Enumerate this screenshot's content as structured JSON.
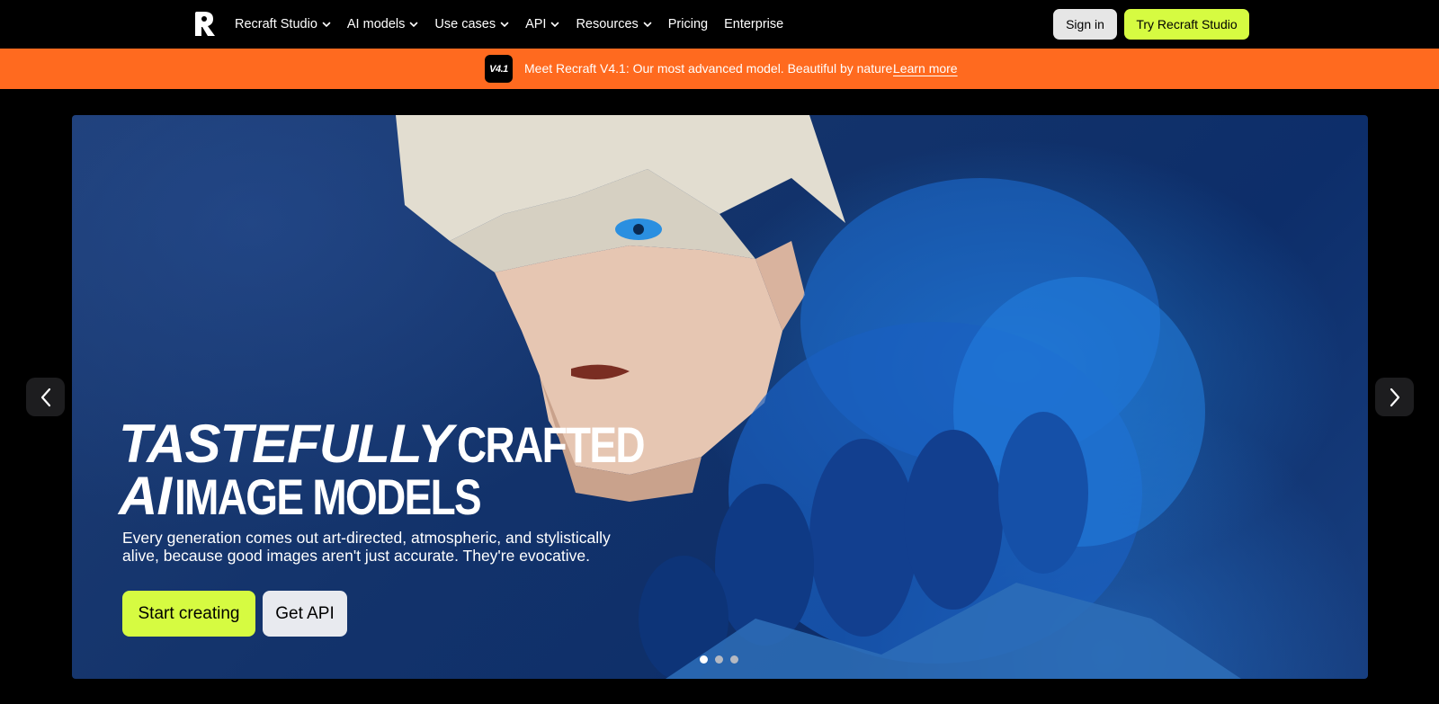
{
  "nav": {
    "items": [
      {
        "label": "Recraft Studio",
        "dropdown": true
      },
      {
        "label": "AI models",
        "dropdown": true
      },
      {
        "label": "Use cases",
        "dropdown": true
      },
      {
        "label": "API",
        "dropdown": true
      },
      {
        "label": "Resources",
        "dropdown": true
      },
      {
        "label": "Pricing",
        "dropdown": false
      },
      {
        "label": "Enterprise",
        "dropdown": false
      }
    ],
    "sign_in": "Sign in",
    "try_button": "Try Recraft Studio"
  },
  "banner": {
    "badge": "V4.1",
    "text": "Meet Recraft V4.1: Our most advanced model. Beautiful by nature.",
    "link": "Learn more"
  },
  "hero": {
    "title_line1_italic": "TASTEFULLY",
    "title_line1_cond": "CRAFTED",
    "title_line2_italic": "AI",
    "title_line2_cond": "IMAGE MODELS",
    "subtitle": "Every generation comes out art-directed, atmospheric, and stylistically alive, because good images aren't just accurate. They're evocative.",
    "primary_cta": "Start creating",
    "secondary_cta": "Get API",
    "slides": {
      "count": 3,
      "active": 0
    }
  },
  "colors": {
    "accent": "#d6fb41",
    "banner": "#ff6a1f",
    "background": "#000000"
  }
}
